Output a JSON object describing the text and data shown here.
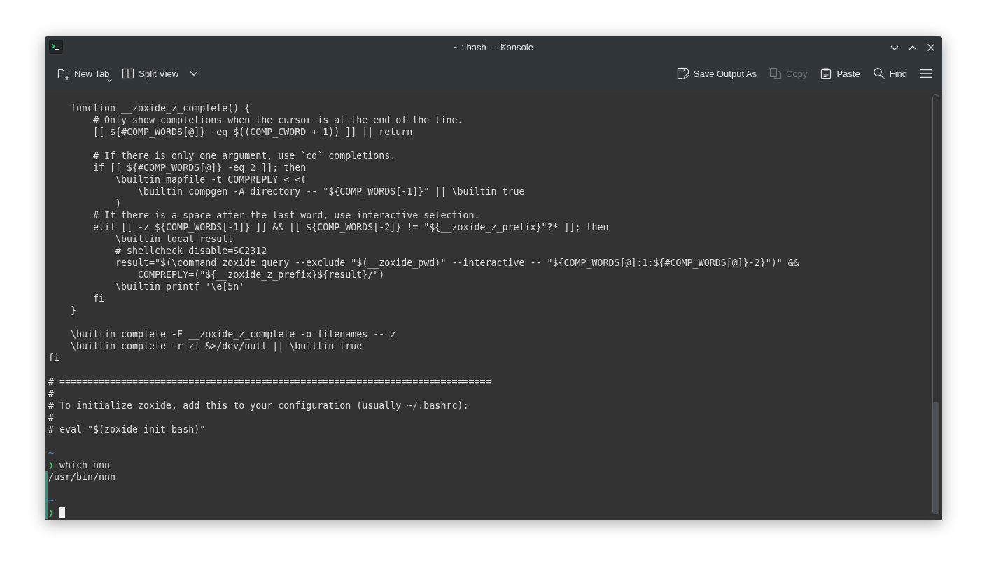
{
  "window": {
    "title": "~ : bash — Konsole"
  },
  "toolbar": {
    "left": [
      {
        "kind": "new-tab",
        "label": "New Tab",
        "disabled": false
      },
      {
        "kind": "split",
        "label": "Split View",
        "disabled": false
      }
    ],
    "right": [
      {
        "kind": "save",
        "label": "Save Output As",
        "disabled": false
      },
      {
        "kind": "copy",
        "label": "Copy",
        "disabled": true
      },
      {
        "kind": "paste",
        "label": "Paste",
        "disabled": false
      },
      {
        "kind": "find",
        "label": "Find",
        "disabled": false
      }
    ]
  },
  "terminal": {
    "lines": [
      {
        "kind": "blank"
      },
      {
        "kind": "text",
        "text": "    function __zoxide_z_complete() {"
      },
      {
        "kind": "text",
        "text": "        # Only show completions when the cursor is at the end of the line."
      },
      {
        "kind": "text",
        "text": "        [[ ${#COMP_WORDS[@]} -eq $((COMP_CWORD + 1)) ]] || return"
      },
      {
        "kind": "blank"
      },
      {
        "kind": "text",
        "text": "        # If there is only one argument, use `cd` completions."
      },
      {
        "kind": "text",
        "text": "        if [[ ${#COMP_WORDS[@]} -eq 2 ]]; then"
      },
      {
        "kind": "text",
        "text": "            \\builtin mapfile -t COMPREPLY < <("
      },
      {
        "kind": "text",
        "text": "                \\builtin compgen -A directory -- \"${COMP_WORDS[-1]}\" || \\builtin true"
      },
      {
        "kind": "text",
        "text": "            )"
      },
      {
        "kind": "text",
        "text": "        # If there is a space after the last word, use interactive selection."
      },
      {
        "kind": "text",
        "text": "        elif [[ -z ${COMP_WORDS[-1]} ]] && [[ ${COMP_WORDS[-2]} != \"${__zoxide_z_prefix}\"?* ]]; then"
      },
      {
        "kind": "text",
        "text": "            \\builtin local result"
      },
      {
        "kind": "text",
        "text": "            # shellcheck disable=SC2312"
      },
      {
        "kind": "text",
        "text": "            result=\"$(\\command zoxide query --exclude \"$(__zoxide_pwd)\" --interactive -- \"${COMP_WORDS[@]:1:${#COMP_WORDS[@]}-2}\")\" &&"
      },
      {
        "kind": "text",
        "text": "                COMPREPLY=(\"${__zoxide_z_prefix}${result}/\")"
      },
      {
        "kind": "text",
        "text": "            \\builtin printf '\\e[5n'"
      },
      {
        "kind": "text",
        "text": "        fi"
      },
      {
        "kind": "text",
        "text": "    }"
      },
      {
        "kind": "blank"
      },
      {
        "kind": "text",
        "text": "    \\builtin complete -F __zoxide_z_complete -o filenames -- z"
      },
      {
        "kind": "text",
        "text": "    \\builtin complete -r zi &>/dev/null || \\builtin true"
      },
      {
        "kind": "text",
        "text": "fi"
      },
      {
        "kind": "blank"
      },
      {
        "kind": "text",
        "text": "# ============================================================================="
      },
      {
        "kind": "text",
        "text": "#"
      },
      {
        "kind": "text",
        "text": "# To initialize zoxide, add this to your configuration (usually ~/.bashrc):"
      },
      {
        "kind": "text",
        "text": "#"
      },
      {
        "kind": "text",
        "text": "# eval \"$(zoxide init bash)\""
      },
      {
        "kind": "blank"
      },
      {
        "kind": "path",
        "text": "~",
        "marked": false
      },
      {
        "kind": "prompt",
        "symbol": "❯",
        "text": "which nnn",
        "cursor": false,
        "marked": false
      },
      {
        "kind": "text",
        "text": "/usr/bin/nnn",
        "marked": true
      },
      {
        "kind": "blank",
        "marked": true
      },
      {
        "kind": "path",
        "text": "~",
        "marked": true
      },
      {
        "kind": "prompt",
        "symbol": "❯",
        "cursor": true,
        "marked": true
      }
    ]
  }
}
